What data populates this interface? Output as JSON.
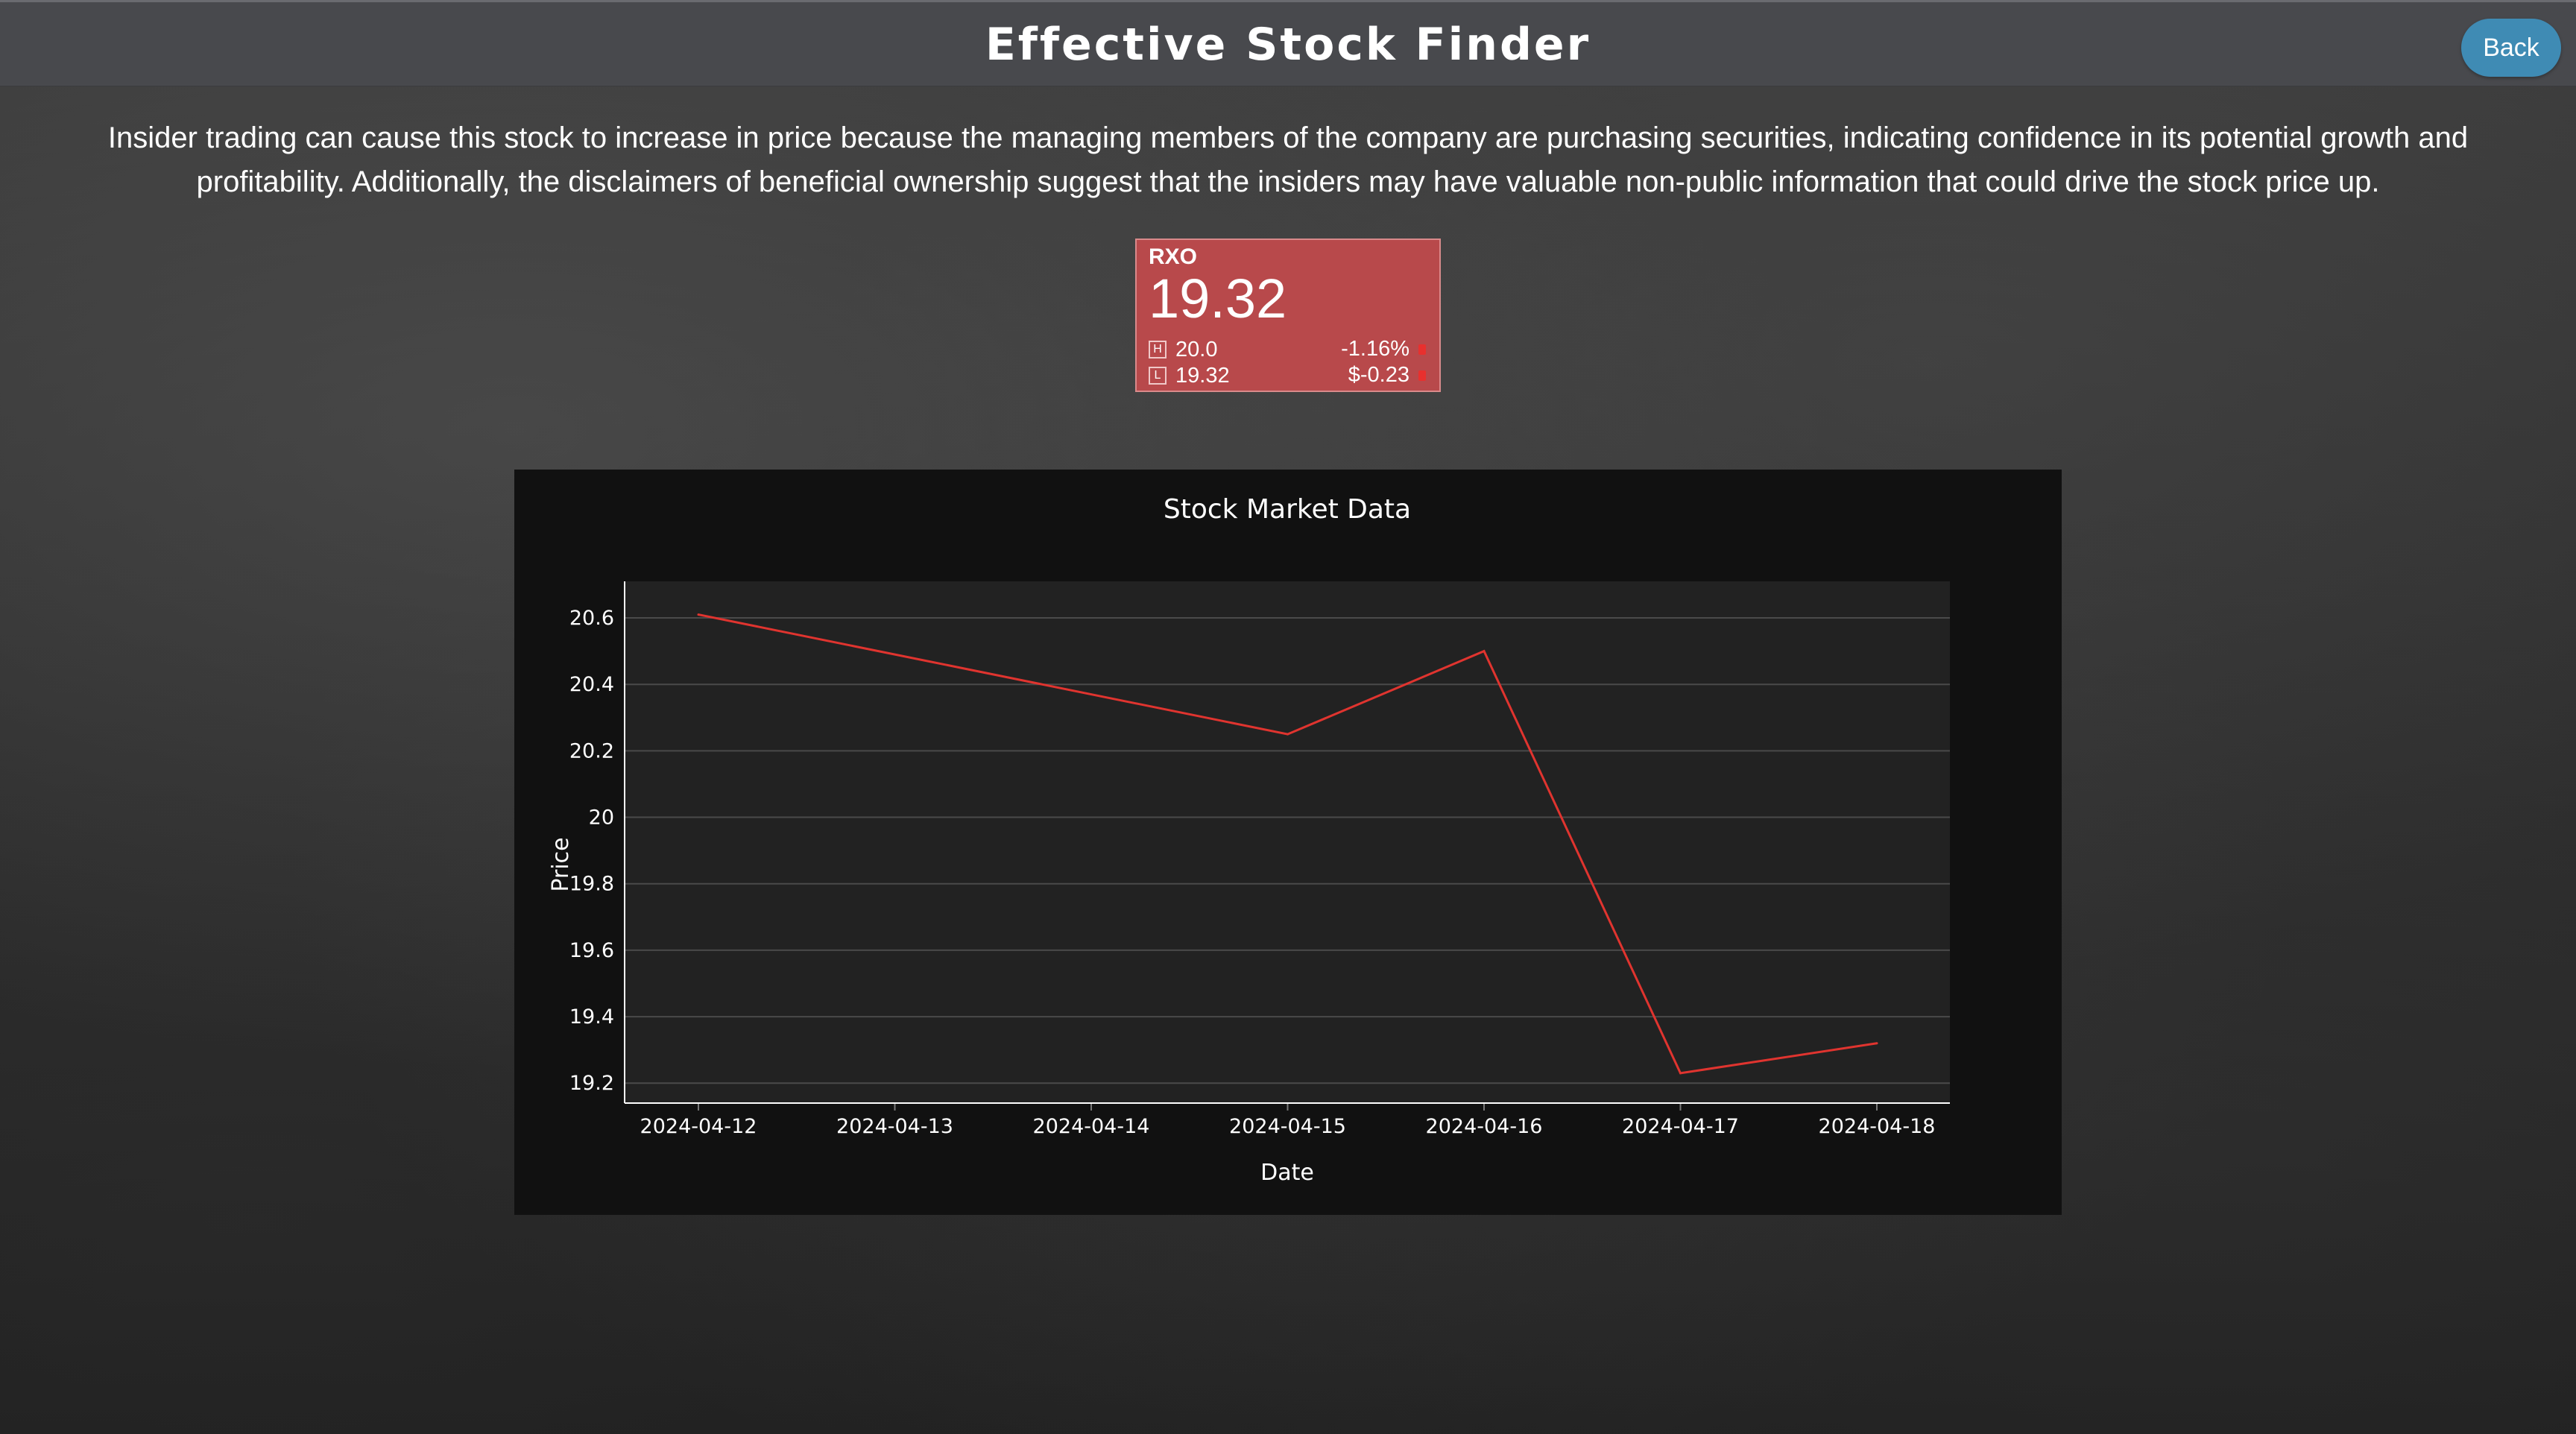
{
  "header": {
    "title": "Effective Stock Finder",
    "back_label": "Back"
  },
  "description": "Insider trading can cause this stock to increase in price because the managing members of the company are purchasing securities, indicating confidence in its potential growth and profitability. Additionally, the disclaimers of beneficial ownership suggest that the insiders may have valuable non-public information that could drive the stock price up.",
  "ticker": {
    "symbol": "RXO",
    "price": "19.32",
    "high_label": "H",
    "high": "20.0",
    "low_label": "L",
    "low": "19.32",
    "change_pct": "-1.16%",
    "change_abs": "$-0.23",
    "color": "#b8494b",
    "down_color": "#e8302e"
  },
  "chart_data": {
    "type": "line",
    "title": "Stock Market Data",
    "xlabel": "Date",
    "ylabel": "Price",
    "x": [
      "2024-04-12",
      "2024-04-13",
      "2024-04-14",
      "2024-04-15",
      "2024-04-16",
      "2024-04-17",
      "2024-04-18"
    ],
    "series": [
      {
        "x": [
          "2024-04-12",
          "2024-04-15",
          "2024-04-16",
          "2024-04-17",
          "2024-04-18"
        ],
        "values": [
          20.61,
          20.25,
          20.5,
          19.23,
          19.32
        ],
        "color": "#e0342f"
      }
    ],
    "yticks": [
      19.2,
      19.4,
      19.6,
      19.8,
      20,
      20.2,
      20.4,
      20.6
    ],
    "ytick_labels": [
      "19.2",
      "19.4",
      "19.6",
      "19.8",
      "20",
      "20.2",
      "20.4",
      "20.6"
    ],
    "ylim": [
      19.14,
      20.71
    ],
    "grid": true,
    "plot_bg": "#222222",
    "paper_bg": "#111111"
  }
}
